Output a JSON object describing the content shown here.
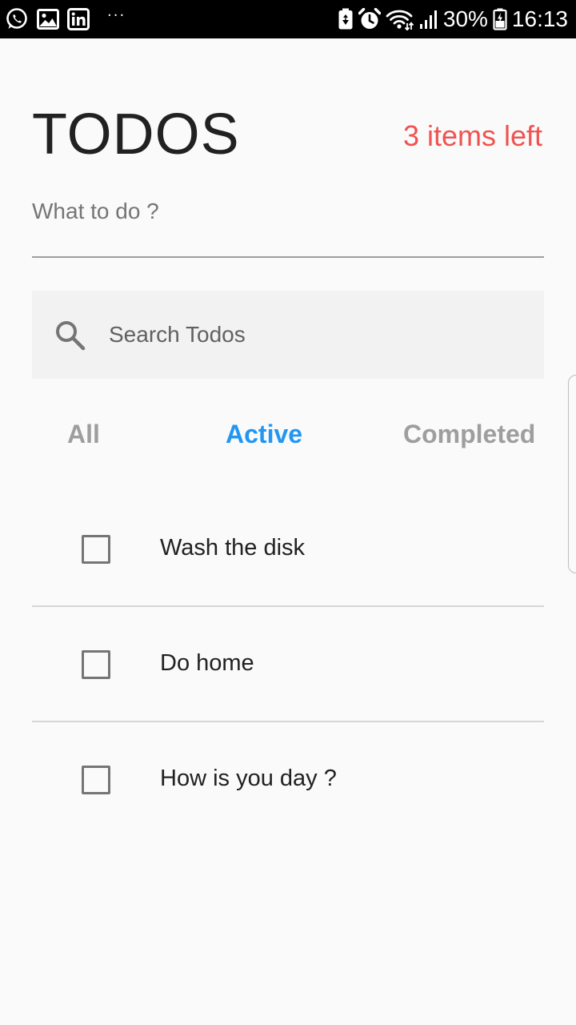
{
  "status_bar": {
    "left_icons": [
      "whatsapp-icon",
      "gallery-icon",
      "linkedin-icon",
      "more-dots-icon"
    ],
    "more_label": "···",
    "right_icons": [
      "battery-saver-icon",
      "alarm-icon",
      "wifi-icon",
      "signal-icon",
      "battery-icon"
    ],
    "battery_percent": "30%",
    "time": "16:13"
  },
  "header": {
    "title": "TODOS",
    "items_left": "3 items left",
    "items_left_color": "#ef5350"
  },
  "new_todo": {
    "placeholder": "What to do ?",
    "value": ""
  },
  "search": {
    "icon": "search-icon",
    "placeholder": "Search Todos",
    "value": ""
  },
  "filters": {
    "tabs": [
      {
        "label": "All",
        "active": false
      },
      {
        "label": "Active",
        "active": true
      },
      {
        "label": "Completed",
        "active": false
      }
    ],
    "active_color": "#2196f3",
    "inactive_color": "#9e9e9e"
  },
  "todos": [
    {
      "text": "Wash the disk",
      "completed": false
    },
    {
      "text": "Do home",
      "completed": false
    },
    {
      "text": "How is you day ?",
      "completed": false
    }
  ]
}
